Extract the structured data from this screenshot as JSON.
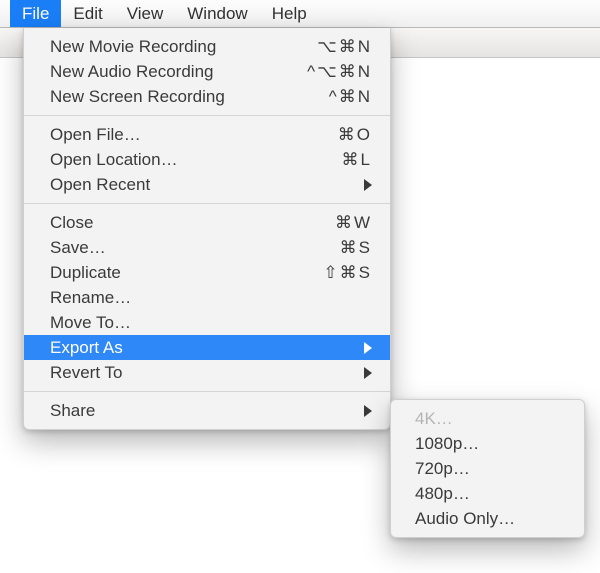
{
  "menubar": {
    "items": [
      {
        "label": "File",
        "open": true
      },
      {
        "label": "Edit"
      },
      {
        "label": "View"
      },
      {
        "label": "Window"
      },
      {
        "label": "Help"
      }
    ]
  },
  "file_menu": {
    "groups": [
      [
        {
          "label": "New Movie Recording",
          "shortcut": "⌥⌘N"
        },
        {
          "label": "New Audio Recording",
          "shortcut": "^⌥⌘N"
        },
        {
          "label": "New Screen Recording",
          "shortcut": "^⌘N"
        }
      ],
      [
        {
          "label": "Open File…",
          "shortcut": "⌘O"
        },
        {
          "label": "Open Location…",
          "shortcut": "⌘L"
        },
        {
          "label": "Open Recent",
          "submenu": true
        }
      ],
      [
        {
          "label": "Close",
          "shortcut": "⌘W"
        },
        {
          "label": "Save…",
          "shortcut": "⌘S"
        },
        {
          "label": "Duplicate",
          "shortcut": "⇧⌘S"
        },
        {
          "label": "Rename…"
        },
        {
          "label": "Move To…"
        },
        {
          "label": "Export As",
          "submenu": true,
          "highlight": true
        },
        {
          "label": "Revert To",
          "submenu": true
        }
      ],
      [
        {
          "label": "Share",
          "submenu": true
        }
      ]
    ]
  },
  "export_submenu": [
    {
      "label": "4K…",
      "disabled": true
    },
    {
      "label": "1080p…"
    },
    {
      "label": "720p…"
    },
    {
      "label": "480p…"
    },
    {
      "label": "Audio Only…"
    }
  ]
}
